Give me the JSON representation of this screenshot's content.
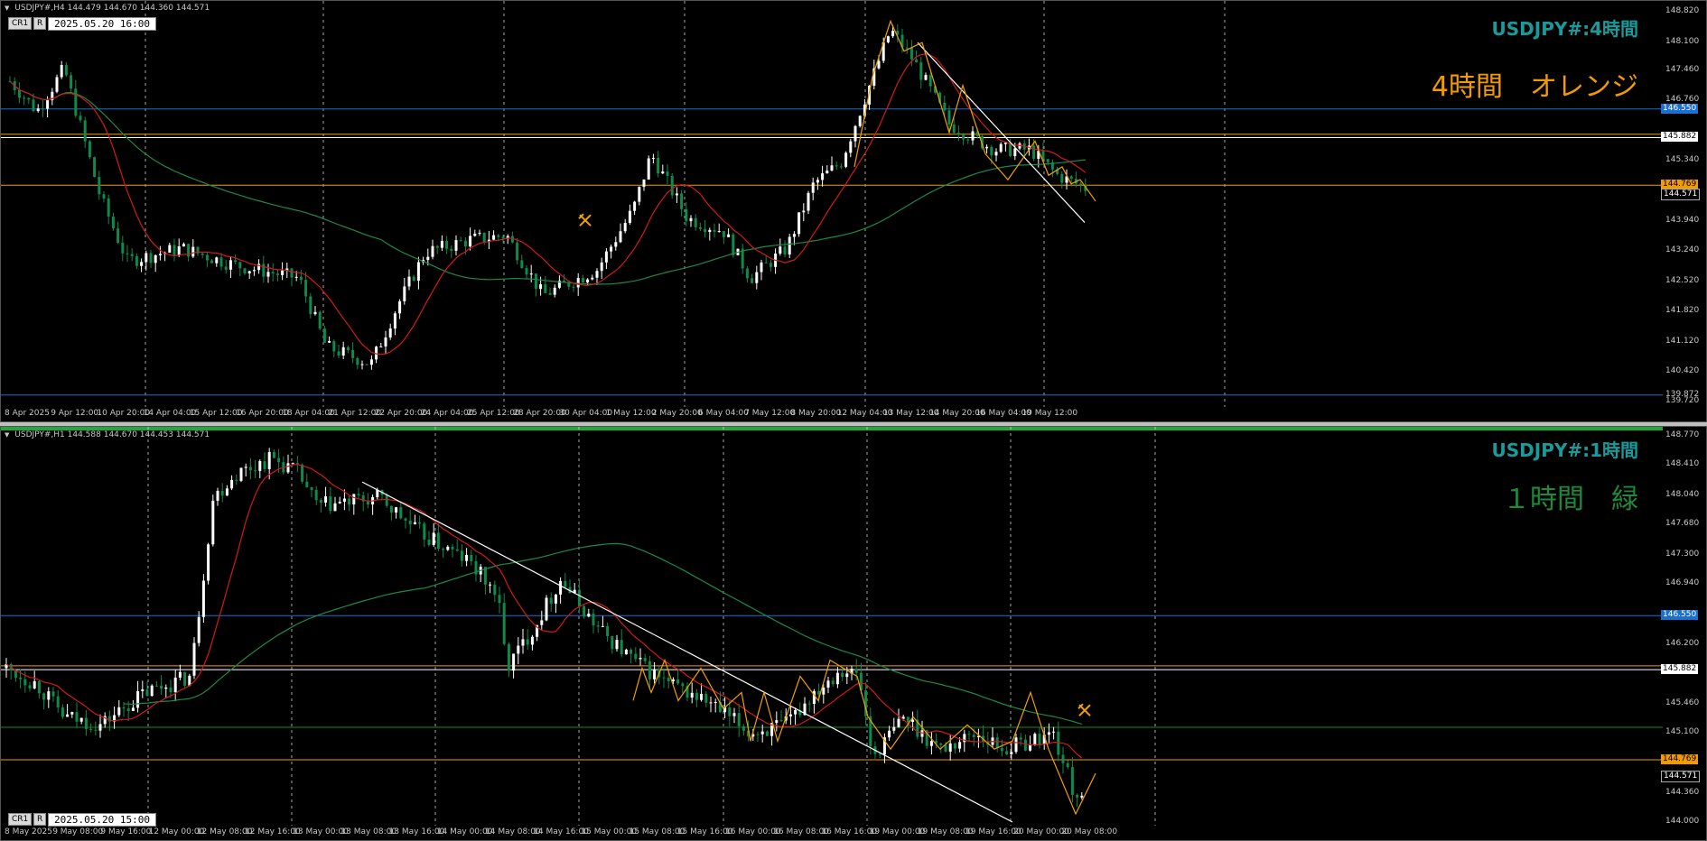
{
  "top": {
    "header_text": "USDJPY#,H4  144.479 144.670 144.360 144.571",
    "tag_cr1": "CR1",
    "tag_r": "R",
    "date_box": "2025.05.20 16:00",
    "title": "USDJPY#:4時間",
    "subtitle": "4時間　オレンジ",
    "title_color": "#1a9a9a",
    "subtitle_color": "#f29a00",
    "price_labels": [
      "148.820",
      "148.100",
      "147.460",
      "146.760",
      "146.550",
      "145.882",
      "145.340",
      "144.769",
      "144.571",
      "143.940",
      "143.240",
      "142.520",
      "141.820",
      "141.120",
      "140.420",
      "139.872",
      "139.720"
    ],
    "time_labels": [
      "8 Apr 2025",
      "9 Apr 12:00",
      "10 Apr 20:00",
      "14 Apr 04:00",
      "15 Apr 12:00",
      "16 Apr 20:00",
      "18 Apr 04:00",
      "21 Apr 12:00",
      "22 Apr 20:00",
      "24 Apr 04:00",
      "25 Apr 12:00",
      "28 Apr 20:00",
      "30 Apr 04:00",
      "1 May 12:00",
      "2 May 20:00",
      "6 May 04:00",
      "7 May 12:00",
      "8 May 20:00",
      "12 May 04:00",
      "13 May 12:00",
      "14 May 20:00",
      "16 May 04:00",
      "19 May 12:00"
    ]
  },
  "bottom": {
    "header_text": "USDJPY#,H1  144.588 144.670 144.453 144.571",
    "tag_cr1": "CR1",
    "tag_r": "R",
    "date_box": "2025.05.20 15:00",
    "title": "USDJPY#:1時間",
    "subtitle": "１時間　緑",
    "title_color": "#1a9a9a",
    "subtitle_color": "#1e8a3a",
    "price_labels": [
      "148.770",
      "148.410",
      "148.040",
      "147.680",
      "147.300",
      "146.940",
      "146.550",
      "146.200",
      "145.882",
      "145.460",
      "145.100",
      "144.769",
      "144.571",
      "144.360",
      "144.000"
    ],
    "time_labels": [
      "8 May 2025",
      "9 May 08:00",
      "9 May 16:00",
      "12 May 00:00",
      "12 May 08:00",
      "12 May 16:00",
      "13 May 00:00",
      "13 May 08:00",
      "13 May 16:00",
      "14 May 00:00",
      "14 May 08:00",
      "14 May 16:00",
      "15 May 00:00",
      "15 May 08:00",
      "15 May 16:00",
      "16 May 00:00",
      "16 May 08:00",
      "16 May 16:00",
      "19 May 00:00",
      "19 May 08:00",
      "19 May 16:00",
      "20 May 00:00",
      "20 May 08:00"
    ]
  },
  "colors": {
    "bull": "#ffffff",
    "bear": "#0e8a4a",
    "ma_red": "#d11a1a",
    "ma_green": "#1a8a4a",
    "hline_blue": "#1a6fd1",
    "hline_orange": "#f29a00",
    "hline_white": "#ffffff",
    "hline_green": "#1a8a1a",
    "zigzag": "#f2a000",
    "trendline": "#ffffff"
  }
}
